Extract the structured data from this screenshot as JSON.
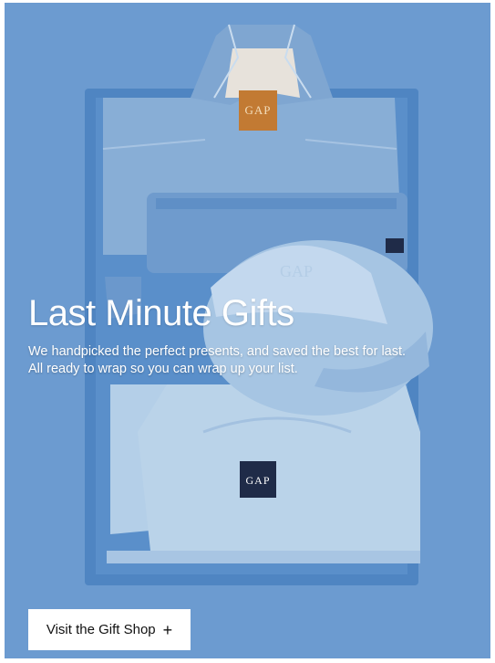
{
  "hero": {
    "title": "Last Minute Gifts",
    "description": "We handpicked the perfect presents, and saved the best for last. All ready to wrap so you can wrap up your list.",
    "jacket_label": "GAP",
    "hoodie_label": "GAP",
    "cap_label": "GAP"
  },
  "cta": {
    "label": "Visit the Gift Shop",
    "icon": "plus-icon",
    "icon_glyph": "+"
  },
  "colors": {
    "background": "#6c9bd0",
    "tray": "#4f85c2",
    "denim": "#8fb4d8",
    "hoodie": "#bad3e9",
    "label_brown": "#c27a33",
    "label_navy": "#1f2b48",
    "button": "#ffffff"
  }
}
